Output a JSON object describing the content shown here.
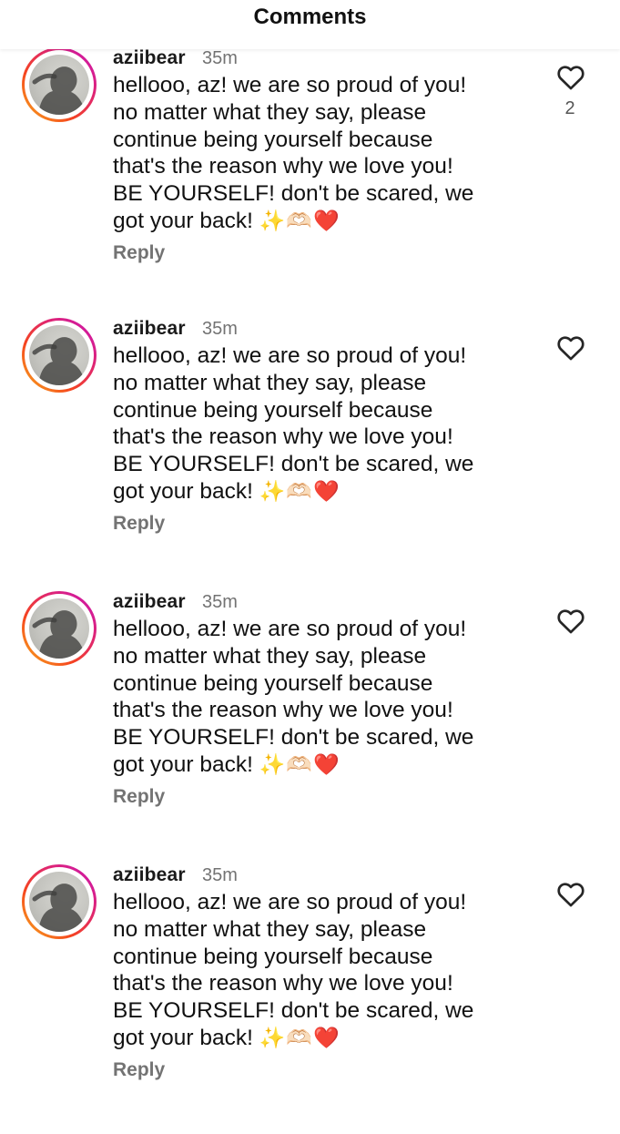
{
  "header": {
    "title": "Comments"
  },
  "comments": [
    {
      "username": "aziibear",
      "time": "35m",
      "lines": [
        "hellooo, az! we are so proud of you!",
        "no matter what they say, please",
        "continue being yourself because",
        "that's the reason why we love you!",
        "BE YOURSELF! don't be scared, we",
        "got your back!"
      ],
      "emoji": "✨🫶🏻❤️",
      "reply_label": "Reply",
      "likes": "2"
    },
    {
      "username": "aziibear",
      "time": "35m",
      "lines": [
        "hellooo, az! we are so proud of you!",
        "no matter what they say, please",
        "continue being yourself because",
        "that's the reason why we love you!",
        "BE YOURSELF! don't be scared, we",
        "got your back!"
      ],
      "emoji": "✨🫶🏻❤️",
      "reply_label": "Reply",
      "likes": ""
    },
    {
      "username": "aziibear",
      "time": "35m",
      "lines": [
        "hellooo, az! we are so proud of you!",
        "no matter what they say, please",
        "continue being yourself because",
        "that's the reason why we love you!",
        "BE YOURSELF! don't be scared, we",
        "got your back!"
      ],
      "emoji": "✨🫶🏻❤️",
      "reply_label": "Reply",
      "likes": ""
    },
    {
      "username": "aziibear",
      "time": "35m",
      "lines": [
        "hellooo, az! we are so proud of you!",
        "no matter what they say, please",
        "continue being yourself because",
        "that's the reason why we love you!",
        "BE YOURSELF! don't be scared, we",
        "got your back!"
      ],
      "emoji": "✨🫶🏻❤️",
      "reply_label": "Reply",
      "likes": ""
    }
  ],
  "icons": {
    "like": "heart-outline-icon",
    "avatar": "profile-photo"
  },
  "colors": {
    "story_ring_start": "#c913b9",
    "story_ring_end": "#f8b21c",
    "secondary_text": "#737373"
  }
}
